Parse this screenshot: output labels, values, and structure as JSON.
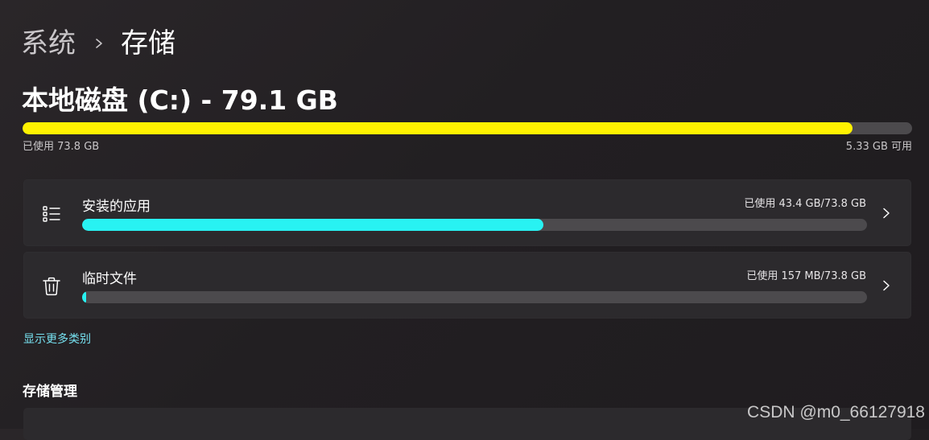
{
  "breadcrumb": {
    "parent": "系统",
    "current": "存储"
  },
  "drive": {
    "title": "本地磁盘 (C:) - 79.1 GB",
    "used_label": "已使用 73.8 GB",
    "free_label": "5.33 GB 可用",
    "used_fraction": 0.933,
    "bar_color": "#fff200"
  },
  "categories": [
    {
      "title": "安装的应用",
      "usage": "已使用 43.4 GB/73.8 GB",
      "fraction": 0.588,
      "bar_color": "#28f2f2",
      "icon": "app-list-icon"
    },
    {
      "title": "临时文件",
      "usage": "已使用 157 MB/73.8 GB",
      "fraction": 0.002,
      "bar_color": "#28f2f2",
      "icon": "trash-icon"
    }
  ],
  "show_more": "显示更多类别",
  "storage_management": {
    "heading": "存储管理"
  },
  "watermark": "CSDN @m0_66127918",
  "colors": {
    "accent_link": "#76e1f0",
    "track": "#4c4a4d"
  }
}
